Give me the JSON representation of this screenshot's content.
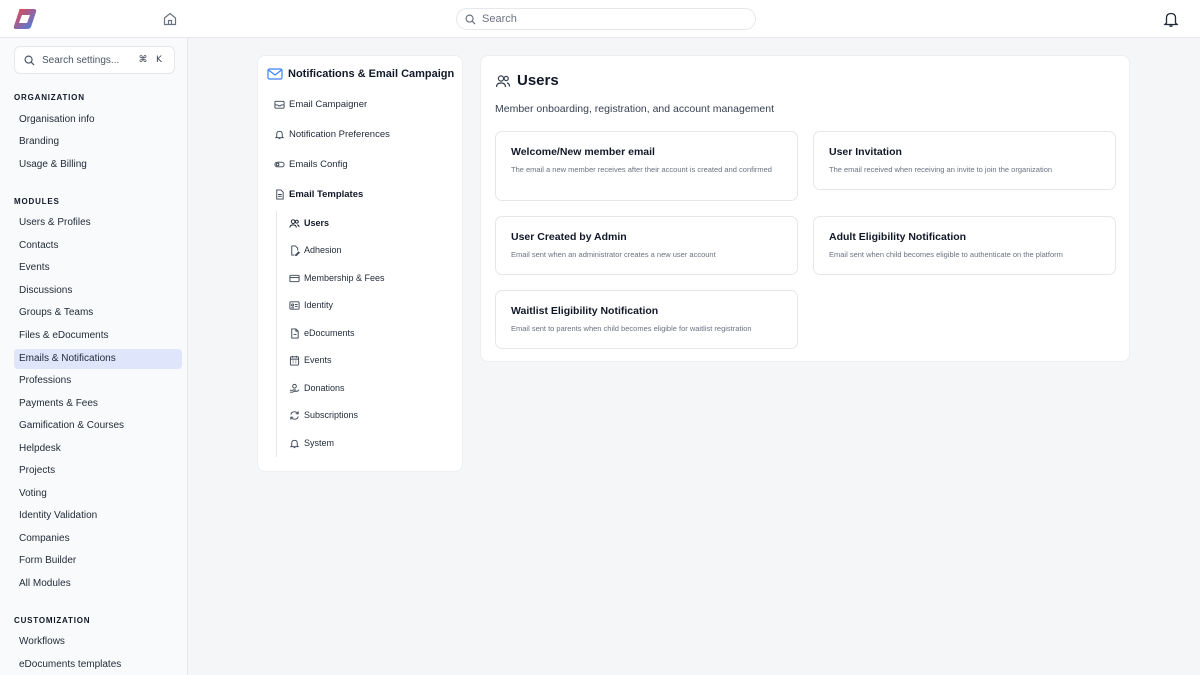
{
  "topbar": {
    "search_placeholder": "Search",
    "icons": [
      "app-logo",
      "home-icon",
      "search-icon",
      "bell-icon"
    ],
    "logo_colors": [
      "#ef4444",
      "#3b82f6"
    ]
  },
  "sidebar": {
    "search_placeholder": "Search settings...",
    "shortcut_keys": [
      "⌘",
      "K"
    ],
    "sections": [
      {
        "title": "ORGANIZATION",
        "items": [
          "Organisation info",
          "Branding",
          "Usage & Billing"
        ]
      },
      {
        "title": "MODULES",
        "items": [
          "Users & Profiles",
          "Contacts",
          "Events",
          "Discussions",
          "Groups & Teams",
          "Files & eDocuments",
          "Emails & Notifications",
          "Professions",
          "Payments & Fees",
          "Gamification & Courses",
          "Helpdesk",
          "Projects",
          "Voting",
          "Identity Validation",
          "Companies",
          "Form Builder",
          "All Modules"
        ]
      },
      {
        "title": "CUSTOMIZATION",
        "items": [
          "Workflows",
          "eDocuments templates"
        ]
      }
    ],
    "active_item": "Emails & Notifications",
    "active_color": "#dfe5fb"
  },
  "nav": {
    "title": "Notifications & Email Campaign",
    "items": [
      {
        "label": "Email Campaigner",
        "icon": "inbox-icon"
      },
      {
        "label": "Notification Preferences",
        "icon": "bell-icon"
      },
      {
        "label": "Emails Config",
        "icon": "toggle-icon"
      },
      {
        "label": "Email Templates",
        "icon": "document-icon"
      }
    ],
    "sub_items": [
      {
        "label": "Users",
        "icon": "users-icon"
      },
      {
        "label": "Adhesion",
        "icon": "file-edit-icon"
      },
      {
        "label": "Membership & Fees",
        "icon": "credit-card-icon"
      },
      {
        "label": "Identity",
        "icon": "id-card-icon"
      },
      {
        "label": "eDocuments",
        "icon": "file-icon"
      },
      {
        "label": "Events",
        "icon": "calendar-icon"
      },
      {
        "label": "Donations",
        "icon": "hand-heart-icon"
      },
      {
        "label": "Subscriptions",
        "icon": "refresh-icon"
      },
      {
        "label": "System",
        "icon": "bell-icon"
      }
    ],
    "active_sub": "Users"
  },
  "main": {
    "title": "Users",
    "subtitle": "Member onboarding, registration, and account management",
    "cards": [
      {
        "title": "Welcome/New member email",
        "desc": "The email a new member receives after their account is created and confirmed"
      },
      {
        "title": "User Invitation",
        "desc": "The email received when receiving an invite to join the organization"
      },
      {
        "title": "User Created by Admin",
        "desc": "Email sent when an administrator creates a new user account"
      },
      {
        "title": "Adult Eligibility Notification",
        "desc": "Email sent when child becomes eligible to authenticate on the platform"
      },
      {
        "title": "Waitlist Eligibility Notification",
        "desc": "Email sent to parents when child becomes eligible for waitlist registration"
      }
    ]
  }
}
